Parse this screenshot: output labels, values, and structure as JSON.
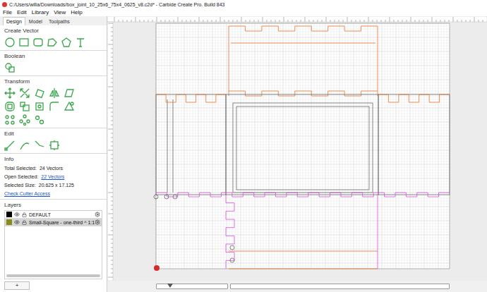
{
  "window": {
    "title": "C:/Users/willa/Downloads/box_joint_10_25x6_75x4_0625_v8.c2d* - Carbide Create Pro. Build 843"
  },
  "menu": [
    "File",
    "Edit",
    "Library",
    "View",
    "Help"
  ],
  "tabs": [
    {
      "label": "Design",
      "selected": true
    },
    {
      "label": "Model",
      "selected": false
    },
    {
      "label": "Toolpaths",
      "selected": false
    }
  ],
  "sections": {
    "create_vector": "Create Vector",
    "boolean": "Boolean",
    "transform": "Transform",
    "edit": "Edit"
  },
  "info": {
    "title": "Info",
    "rows": [
      {
        "label": "Total Selected:",
        "value": "24 Vectors",
        "kind": "text"
      },
      {
        "label": "Open Selected:",
        "value": "22 Vectors",
        "kind": "link"
      },
      {
        "label": "Selected Size:",
        "value": "20.625 x 17.125",
        "kind": "text"
      }
    ],
    "link": "Check Cutter Access"
  },
  "layers": {
    "title": "Layers",
    "items": [
      {
        "name": "DEFAULT",
        "color": "#000000",
        "selected": false
      },
      {
        "name": "Small-Square - one-third ^ 1:1",
        "color": "#8b8b1a",
        "selected": true
      }
    ],
    "add_button": "+"
  }
}
